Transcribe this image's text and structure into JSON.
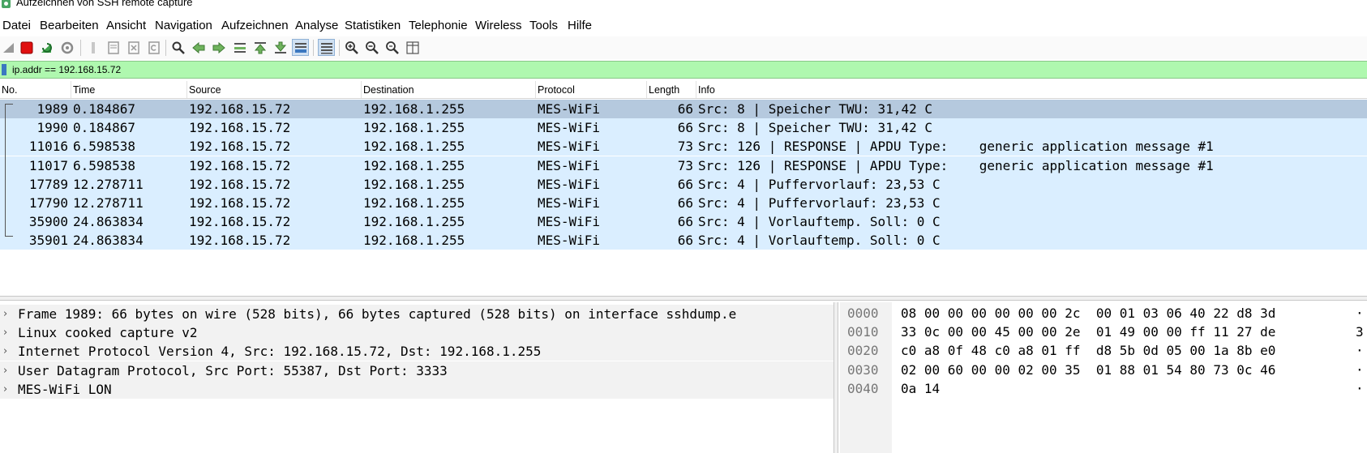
{
  "window": {
    "title": "Aufzeichnen von SSH remote capture"
  },
  "menu": [
    "Datei",
    "Bearbeiten",
    "Ansicht",
    "Navigation",
    "Aufzeichnen",
    "Analyse",
    "Statistiken",
    "Telephonie",
    "Wireless",
    "Tools",
    "Hilfe"
  ],
  "toolbar": {
    "icons": [
      "shark-fin-start-icon",
      "stop-capture-icon",
      "restart-capture-icon",
      "capture-options-icon",
      "open-file-icon",
      "save-file-icon",
      "close-file-icon",
      "reload-file-icon",
      "find-packet-icon",
      "go-back-icon",
      "go-forward-icon",
      "go-to-packet-icon",
      "first-packet-icon",
      "last-packet-icon",
      "auto-scroll-icon",
      "colorize-icon",
      "zoom-in-icon",
      "zoom-out-icon",
      "zoom-normal-icon",
      "resize-columns-icon"
    ]
  },
  "filter": {
    "value": "ip.addr == 192.168.15.72"
  },
  "columns": [
    "No.",
    "Time",
    "Source",
    "Destination",
    "Protocol",
    "Length",
    "Info"
  ],
  "packets": [
    {
      "no": "1989",
      "time": "0.184867",
      "src": "192.168.15.72",
      "dst": "192.168.1.255",
      "proto": "MES-WiFi",
      "len": "66",
      "info": "Src: 8 | Speicher TWU: 31,42 C"
    },
    {
      "no": "1990",
      "time": "0.184867",
      "src": "192.168.15.72",
      "dst": "192.168.1.255",
      "proto": "MES-WiFi",
      "len": "66",
      "info": "Src: 8 | Speicher TWU: 31,42 C"
    },
    {
      "no": "11016",
      "time": "6.598538",
      "src": "192.168.15.72",
      "dst": "192.168.1.255",
      "proto": "MES-WiFi",
      "len": "73",
      "info": "Src: 126 | RESPONSE | APDU Type:    generic application message #1"
    },
    {
      "no": "11017",
      "time": "6.598538",
      "src": "192.168.15.72",
      "dst": "192.168.1.255",
      "proto": "MES-WiFi",
      "len": "73",
      "info": "Src: 126 | RESPONSE | APDU Type:    generic application message #1"
    },
    {
      "no": "17789",
      "time": "12.278711",
      "src": "192.168.15.72",
      "dst": "192.168.1.255",
      "proto": "MES-WiFi",
      "len": "66",
      "info": "Src: 4 | Puffervorlauf: 23,53 C"
    },
    {
      "no": "17790",
      "time": "12.278711",
      "src": "192.168.15.72",
      "dst": "192.168.1.255",
      "proto": "MES-WiFi",
      "len": "66",
      "info": "Src: 4 | Puffervorlauf: 23,53 C"
    },
    {
      "no": "35900",
      "time": "24.863834",
      "src": "192.168.15.72",
      "dst": "192.168.1.255",
      "proto": "MES-WiFi",
      "len": "66",
      "info": "Src: 4 | Vorlauftemp. Soll: 0 C"
    },
    {
      "no": "35901",
      "time": "24.863834",
      "src": "192.168.15.72",
      "dst": "192.168.1.255",
      "proto": "MES-WiFi",
      "len": "66",
      "info": "Src: 4 | Vorlauftemp. Soll: 0 C"
    }
  ],
  "details": [
    "Frame 1989: 66 bytes on wire (528 bits), 66 bytes captured (528 bits) on interface sshdump.e",
    "Linux cooked capture v2",
    "Internet Protocol Version 4, Src: 192.168.15.72, Dst: 192.168.1.255",
    "User Datagram Protocol, Src Port: 55387, Dst Port: 3333",
    "MES-WiFi LON"
  ],
  "bytes": [
    {
      "offset": "0000",
      "hex": "08 00 00 00 00 00 00 2c  00 01 03 06 40 22 d8 3d",
      "ascii": "·"
    },
    {
      "offset": "0010",
      "hex": "33 0c 00 00 45 00 00 2e  01 49 00 00 ff 11 27 de",
      "ascii": "3"
    },
    {
      "offset": "0020",
      "hex": "c0 a8 0f 48 c0 a8 01 ff  d8 5b 0d 05 00 1a 8b e0",
      "ascii": "·"
    },
    {
      "offset": "0030",
      "hex": "02 00 60 00 00 02 00 35  01 88 01 54 80 73 0c 46",
      "ascii": "·"
    },
    {
      "offset": "0040",
      "hex": "0a 14",
      "ascii": "·"
    }
  ],
  "colors": {
    "filter_bg": "#aff8af",
    "row_bg": "#daeeff",
    "selected_row_bg": "#b5c9de",
    "stop_red": "#e01010",
    "icon_green": "#3da24a"
  }
}
